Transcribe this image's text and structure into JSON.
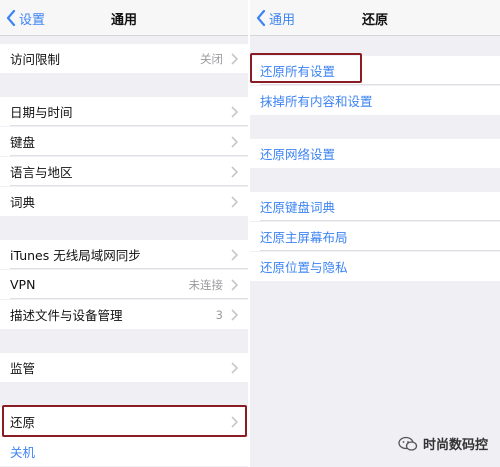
{
  "left": {
    "back_label": "设置",
    "title": "通用",
    "rows": {
      "restrictions": {
        "label": "访问限制",
        "value": "关闭"
      },
      "datetime": {
        "label": "日期与时间"
      },
      "keyboard": {
        "label": "键盘"
      },
      "language": {
        "label": "语言与地区"
      },
      "dictionary": {
        "label": "词典"
      },
      "itunes_sync": {
        "label": "iTunes 无线局域网同步"
      },
      "vpn": {
        "label": "VPN",
        "value": "未连接"
      },
      "profiles": {
        "label": "描述文件与设备管理",
        "value": "3"
      },
      "supervision": {
        "label": "监管"
      },
      "reset": {
        "label": "还原"
      },
      "shutdown": {
        "label": "关机"
      }
    }
  },
  "right": {
    "back_label": "通用",
    "title": "还原",
    "rows": {
      "reset_all_settings": {
        "label": "还原所有设置"
      },
      "erase_all": {
        "label": "抹掉所有内容和设置"
      },
      "reset_network": {
        "label": "还原网络设置"
      },
      "reset_keyboard_dictionary": {
        "label": "还原键盘词典"
      },
      "reset_home_screen": {
        "label": "还原主屏幕布局"
      },
      "reset_location_privacy": {
        "label": "还原位置与隐私"
      }
    }
  },
  "watermark": {
    "text": "时尚数码控"
  },
  "colors": {
    "accent": "#3d84f3",
    "highlight": "#8a1c24",
    "background": "#efeff4"
  }
}
